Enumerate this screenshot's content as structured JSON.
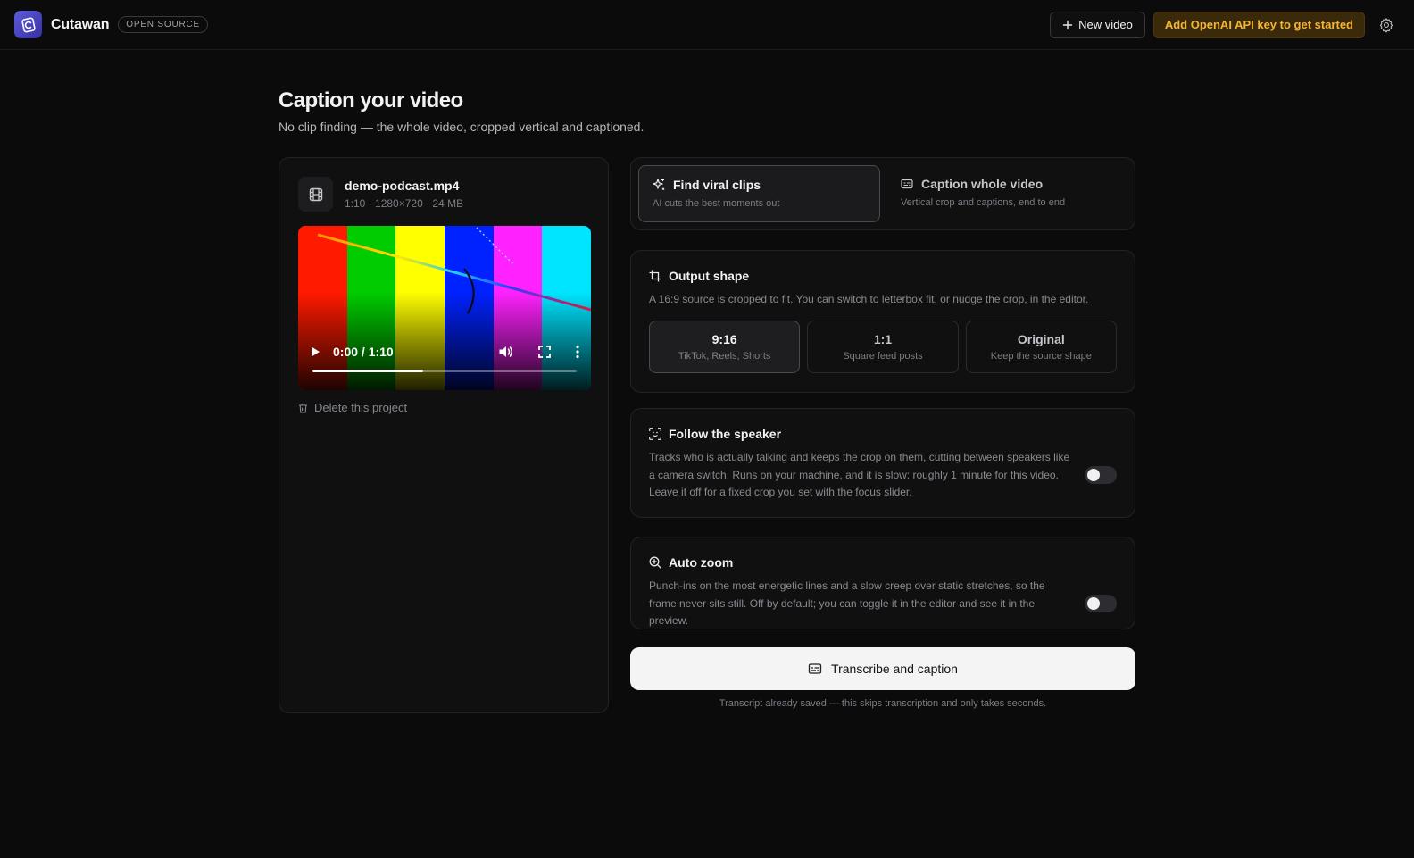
{
  "app": {
    "name": "Cutawan",
    "badge": "OPEN SOURCE",
    "new_video_label": "New video",
    "api_key_label": "Add OpenAI API key to get started",
    "accent_color": "#f3b532"
  },
  "page": {
    "title": "Caption your video",
    "subtitle": "No clip finding — the whole video, cropped vertical and captioned."
  },
  "file": {
    "name": "demo-podcast.mp4",
    "info": "1:10 · 1280×720 · 24 MB",
    "delete_label": "Delete this project"
  },
  "player": {
    "time": "0:00 / 1:10",
    "buffered_fraction": 0.42,
    "bar_colors": [
      "#ff1a00",
      "#00cc00",
      "#ffff00",
      "#0022ff",
      "#ff22ff",
      "#00e5ff"
    ]
  },
  "mode": {
    "options": [
      {
        "label": "Find viral clips",
        "desc": "AI cuts the best moments out",
        "icon": "sparkles-icon",
        "active": true
      },
      {
        "label": "Caption whole video",
        "desc": "Vertical crop and captions, end to end",
        "icon": "captions-icon",
        "active": false
      }
    ]
  },
  "output_shape": {
    "title": "Output shape",
    "desc": "A 16:9 source is cropped to fit. You can switch to letterbox fit, or nudge the crop, in the editor.",
    "options": [
      {
        "label": "9:16",
        "sub": "TikTok, Reels, Shorts",
        "active": true
      },
      {
        "label": "1:1",
        "sub": "Square feed posts",
        "active": false
      },
      {
        "label": "Original",
        "sub": "Keep the source shape",
        "active": false
      }
    ]
  },
  "follow_speaker": {
    "title": "Follow the speaker",
    "desc": "Tracks who is actually talking and keeps the crop on them, cutting between speakers like a camera switch. Runs on your machine, and it is slow: roughly 1 minute for this video. Leave it off for a fixed crop you set with the focus slider.",
    "enabled": false
  },
  "auto_zoom": {
    "title": "Auto zoom",
    "desc": "Punch-ins on the most energetic lines and a slow creep over static stretches, so the frame never sits still. Off by default; you can toggle it in the editor and see it in the preview.",
    "enabled": false
  },
  "cta": {
    "label": "Transcribe and caption",
    "note": "Transcript already saved — this skips transcription and only takes seconds."
  }
}
